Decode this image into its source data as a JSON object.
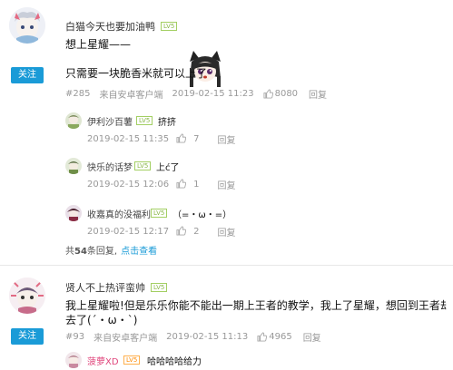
{
  "post1": {
    "username": "白猫今天也要加油鸭",
    "level": "LV5",
    "follow_label": "关注",
    "line1": "想上星耀——",
    "line2": "只需要一块脆香米就可以上了",
    "floor": "#285",
    "client": "来自安卓客户端",
    "time": "2019-02-15 11:23",
    "likes": "8080",
    "reply_label": "回复",
    "replies": [
      {
        "name": "伊利沙百薯",
        "level": "LV5",
        "text": "挤挤",
        "time": "2019-02-15 11:35",
        "likes": "7",
        "reply_label": "回复"
      },
      {
        "name": "快乐的话梦",
        "level": "LV5",
        "text": "上ć了",
        "time": "2019-02-15 12:06",
        "likes": "1",
        "reply_label": "回复"
      },
      {
        "name": "收嘉真的没福利",
        "level": "LV5",
        "text": "（=・ω・=）",
        "time": "2019-02-15 12:17",
        "likes": "2",
        "reply_label": "回复"
      }
    ],
    "total_prefix": "共",
    "total_count": "54",
    "total_suffix": "条回复,",
    "view_label": "点击查看"
  },
  "post2": {
    "username": "贤人不上热评蛮帅",
    "level": "LV5",
    "follow_label": "关注",
    "line1": "我上星耀啦!但是乐乐你能不能出一期上王者的教学，我上了星耀，想回到王者却发现回不",
    "line2": "去了(ˊ・ω・ˋ)",
    "floor": "#93",
    "client": "来自安卓客户端",
    "time": "2019-02-15 11:13",
    "likes": "4965",
    "reply_label": "回复",
    "reply": {
      "name": "菠萝XD",
      "level": "LV5",
      "text": "哈哈哈哈给力"
    }
  }
}
